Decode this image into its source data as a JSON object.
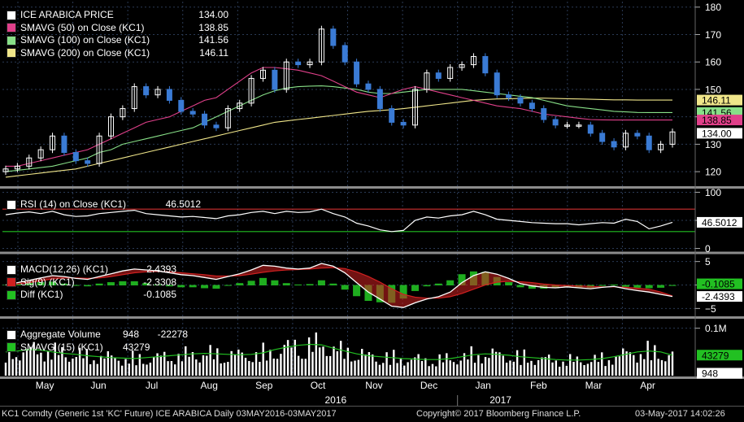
{
  "colors": {
    "price_up": "#ffffff",
    "price_down": "#3a7bd5",
    "sma50": "#e0408a",
    "sma100": "#88e088",
    "sma200": "#f0e68a",
    "rsi": "#ffffff",
    "rsi_upper": "#d03030",
    "rsi_lower": "#22c022",
    "macd": "#ffffff",
    "sig": "#d02020",
    "diff": "#22c022",
    "volume": "#ffffff",
    "vol_sma": "#22c022",
    "grid": "#2a3a55",
    "divider": "#8c8c8c"
  },
  "price_legend": [
    {
      "label": "ICE ARABICA PRICE",
      "value": "134.00",
      "color": "#ffffff"
    },
    {
      "label": "SMAVG (50) on Close (KC1)",
      "value": "138.85",
      "color": "#e0408a"
    },
    {
      "label": "SMAVG (100) on Close (KC1)",
      "value": "141.56",
      "color": "#88e088"
    },
    {
      "label": "SMAVG (200) on Close (KC1)",
      "value": "146.11",
      "color": "#f0e68a"
    }
  ],
  "rsi_legend": {
    "label": "RSI (14) on Close (KC1)",
    "value": "46.5012",
    "color": "#ffffff"
  },
  "macd_legend": [
    {
      "label": "MACD(12,26) (KC1)",
      "value": "-2.4393",
      "color": "#ffffff"
    },
    {
      "label": "Sig(9) (KC1)",
      "value": "-2.3308",
      "color": "#d02020"
    },
    {
      "label": "Diff (KC1)",
      "value": "-0.1085",
      "color": "#22c022"
    }
  ],
  "vol_legend": [
    {
      "label": "Aggregate Volume",
      "value": "948",
      "value2": "-22278",
      "color": "#ffffff"
    },
    {
      "label": "SMAVG (15) (KC1)",
      "value": "43279",
      "color": "#22c022"
    }
  ],
  "footer": {
    "left": "KC1 Comdty (Generic 1st 'KC' Future) ICE ARABICA  Daily 03MAY2016-03MAY2017",
    "center": "Copyright© 2017 Bloomberg Finance L.P.",
    "right": "03-May-2017 14:02:26"
  },
  "chart_data": {
    "type": "line",
    "x_months": [
      "May",
      "Jun",
      "Jul",
      "Aug",
      "Sep",
      "Oct",
      "Nov",
      "Dec",
      "Jan",
      "Feb",
      "Mar",
      "Apr"
    ],
    "x_years": [
      {
        "label": "2016",
        "at": 6
      },
      {
        "label": "2017",
        "at": 9
      }
    ],
    "panels": {
      "price": {
        "ylim": [
          115,
          182
        ],
        "yticks": [
          120,
          130,
          140,
          150,
          160,
          170,
          180
        ],
        "close": [
          121,
          122,
          125,
          128,
          133,
          127,
          124,
          123,
          133,
          140,
          143,
          151,
          148,
          150,
          146,
          142,
          141,
          137,
          136,
          143,
          145,
          154,
          157,
          150,
          160,
          159,
          160,
          172,
          166,
          160,
          152,
          150,
          143,
          138,
          137,
          150,
          156,
          154,
          158,
          159,
          162,
          156,
          148,
          147,
          145,
          143,
          139,
          137,
          137,
          137,
          134,
          131,
          129,
          134,
          133,
          128,
          130,
          134.5
        ],
        "sma50": [
          122,
          122,
          123,
          124,
          125,
          126,
          127,
          128,
          130,
          132,
          134,
          136,
          138,
          139,
          140,
          142,
          144,
          146,
          147,
          150,
          153,
          156,
          158,
          158,
          157.5,
          157,
          156,
          155,
          153,
          151,
          149,
          148,
          147,
          148.5,
          150,
          151,
          150,
          149,
          148,
          147,
          146,
          145,
          144,
          143.5,
          143,
          142,
          141,
          140.5,
          140,
          139.5,
          139,
          138.9,
          138.85,
          138.85,
          138.85,
          138.85,
          138.85,
          138.85
        ],
        "sma100": [
          120,
          120.5,
          121,
          121.5,
          122,
          123,
          124,
          125,
          127,
          128,
          130,
          131,
          132,
          133,
          134,
          135,
          136,
          138,
          140,
          142,
          144,
          146,
          148,
          149.5,
          150.5,
          151,
          151.2,
          151.3,
          151,
          150.5,
          150,
          149,
          148.5,
          148.5,
          149,
          149.5,
          150,
          150,
          150,
          150,
          149.5,
          149,
          148.5,
          148,
          147.5,
          147,
          146,
          145,
          144,
          143.5,
          143,
          142.5,
          142,
          141.8,
          141.6,
          141.56,
          141.56,
          141.56
        ],
        "sma200": [
          118,
          118.5,
          119,
          119.5,
          120,
          120.5,
          121,
          122,
          123,
          124,
          125,
          126,
          127,
          128,
          129,
          130,
          131,
          132,
          133,
          134,
          135,
          136,
          137,
          138,
          138.5,
          139,
          139.5,
          140,
          140.5,
          141,
          141.5,
          142,
          142.3,
          142.6,
          143,
          143.5,
          144,
          144.5,
          145,
          145.5,
          146,
          146.3,
          146.5,
          146.6,
          146.7,
          146.8,
          146.8,
          146.7,
          146.6,
          146.5,
          146.4,
          146.3,
          146.2,
          146.2,
          146.1,
          146.11,
          146.11,
          146.11
        ],
        "markers": [
          {
            "value": "146.11",
            "v": 146.11,
            "color": "#f0e68a"
          },
          {
            "value": "141.56",
            "v": 141.56,
            "color": "#88e088"
          },
          {
            "value": "138.85",
            "v": 138.85,
            "color": "#e0408a"
          },
          {
            "value": "134.00",
            "v": 134.0,
            "color": "#ffffff"
          }
        ]
      },
      "rsi": {
        "ylim": [
          -5,
          105
        ],
        "yticks": [
          0,
          50,
          100
        ],
        "upper": 70,
        "lower": 30,
        "values": [
          60,
          63,
          65,
          62,
          66,
          60,
          57,
          58,
          62,
          64,
          66,
          68,
          62,
          60,
          58,
          56,
          57,
          55,
          53,
          58,
          60,
          64,
          66,
          62,
          66,
          64,
          65,
          70,
          62,
          56,
          45,
          40,
          33,
          30,
          32,
          50,
          56,
          54,
          58,
          60,
          66,
          60,
          52,
          50,
          48,
          46,
          45,
          44,
          44,
          42,
          44,
          46,
          45,
          52,
          48,
          35,
          40,
          46.5
        ],
        "marker": {
          "value": "46.5012",
          "v": 46.5
        }
      },
      "macd": {
        "ylim": [
          -6.5,
          6.5
        ],
        "yticks": [
          5,
          0,
          -5
        ],
        "macd": [
          0,
          0.5,
          1,
          1.5,
          2,
          1.8,
          1.4,
          1.2,
          1.8,
          2.4,
          3,
          3.4,
          3.2,
          3,
          2.6,
          2.2,
          2.0,
          1.6,
          1.2,
          1.8,
          2.4,
          3.2,
          4.2,
          4.0,
          3.6,
          3.4,
          3.6,
          4.6,
          4.0,
          2.6,
          0.5,
          -1.5,
          -3.0,
          -4.5,
          -4.8,
          -3.8,
          -3.0,
          -2.5,
          -1.5,
          0.5,
          2.0,
          2.8,
          2.3,
          1.4,
          0.3,
          -0.2,
          -0.5,
          -0.6,
          -0.4,
          -0.6,
          -0.8,
          -0.5,
          -0.3,
          -0.8,
          -1.2,
          -1.5,
          -2.0,
          -2.44
        ],
        "sig": [
          0,
          0.2,
          0.5,
          0.9,
          1.3,
          1.5,
          1.5,
          1.4,
          1.5,
          1.8,
          2.2,
          2.6,
          2.8,
          2.9,
          2.8,
          2.6,
          2.4,
          2.2,
          1.9,
          1.9,
          2.0,
          2.3,
          2.7,
          3.0,
          3.2,
          3.3,
          3.4,
          3.6,
          3.7,
          3.5,
          2.8,
          1.8,
          0.6,
          -0.8,
          -2.0,
          -2.6,
          -2.8,
          -2.8,
          -2.5,
          -1.8,
          -0.9,
          0.0,
          0.6,
          0.8,
          0.7,
          0.5,
          0.2,
          -0.0,
          -0.1,
          -0.2,
          -0.3,
          -0.4,
          -0.4,
          -0.5,
          -0.7,
          -0.9,
          -1.5,
          -2.33
        ],
        "marker_diff": {
          "value": "-0.1085",
          "v": 0.25
        },
        "marker_macd": {
          "value": "-2.4393",
          "v": -2.44
        }
      },
      "volume": {
        "ylim": [
          0,
          120000
        ],
        "yticks_labels": [
          {
            "label": "0.1M",
            "v": 100000
          }
        ],
        "sma15": [
          50000,
          52000,
          55000,
          54000,
          50000,
          47000,
          45000,
          42000,
          40000,
          38000,
          37000,
          36000,
          38000,
          40000,
          42000,
          44000,
          46000,
          47000,
          46000,
          45000,
          44000,
          45000,
          48000,
          55000,
          60000,
          64000,
          66000,
          65000,
          58000,
          52000,
          46000,
          42000,
          40000,
          38000,
          36000,
          35000,
          34000,
          34000,
          36000,
          40000,
          44000,
          46000,
          45000,
          43000,
          40000,
          38000,
          36000,
          34000,
          33000,
          33000,
          34000,
          36000,
          40000,
          45000,
          50000,
          52000,
          50000,
          43279
        ],
        "marker_sma": {
          "value": "43279",
          "v": 43279
        },
        "marker_vol": {
          "value": "948",
          "v": 948
        }
      }
    }
  }
}
